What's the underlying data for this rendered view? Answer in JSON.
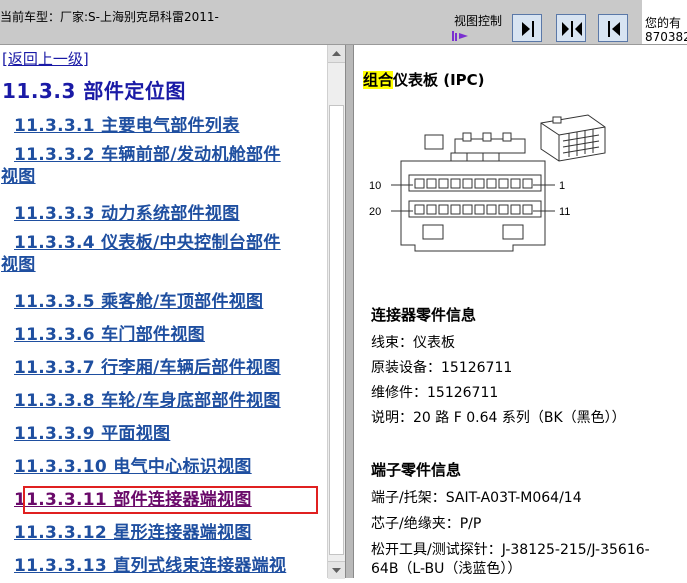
{
  "header": {
    "car_model": "当前车型：厂家:S-上海别克昂科雷2011-",
    "view_control_label": "视图控制",
    "user_line1": "您的有",
    "user_line2": "870382"
  },
  "toc": {
    "back_link": "[返回上一级]",
    "section_title": "11.3.3  部件定位图",
    "items": [
      {
        "label": "11.3.3.1  主要电气部件列表",
        "tail": ""
      },
      {
        "label": "11.3.3.2  车辆前部/发动机舱部件",
        "tail": "视图"
      },
      {
        "label": "11.3.3.3  动力系统部件视图",
        "tail": ""
      },
      {
        "label": "11.3.3.4  仪表板/中央控制台部件",
        "tail": "视图"
      },
      {
        "label": "11.3.3.5  乘客舱/车顶部件视图",
        "tail": ""
      },
      {
        "label": "11.3.3.6  车门部件视图",
        "tail": ""
      },
      {
        "label": "11.3.3.7  行李厢/车辆后部件视图",
        "tail": ""
      },
      {
        "label": "11.3.3.8  车轮/车身底部部件视图",
        "tail": ""
      },
      {
        "label": "11.3.3.9  平面视图",
        "tail": ""
      },
      {
        "label": "11.3.3.10  电气中心标识视图",
        "tail": ""
      },
      {
        "label": "11.3.3.11  部件连接器端视图",
        "tail": ""
      },
      {
        "label": "11.3.3.12  星形连接器端视图",
        "tail": ""
      },
      {
        "label": "11.3.3.13  直列式线束连接器端视",
        "tail": ""
      }
    ]
  },
  "component": {
    "title_highlight": "组合",
    "title_rest": "仪表板  (IPC)",
    "pin_labels": {
      "top_left": "10",
      "top_right": "1",
      "bottom_left": "20",
      "bottom_right": "11"
    }
  },
  "connector_info": {
    "heading": "连接器零件信息",
    "harness": "线束：仪表板",
    "oem": "原装设备：15126711",
    "service": "维修件：15126711",
    "desc": "说明：20 路  F 0.64 系列（BK（黑色））"
  },
  "terminal_info": {
    "heading": "端子零件信息",
    "terminal": "端子/托架：SAIT-A03T-M064/14",
    "core": "芯子/绝缘夹：P/P",
    "tool_line1": "松开工具/测试探针：J-38125-215/J-35616-",
    "tool_line2": "64B（L-BU（浅蓝色））"
  },
  "colors": {
    "link": "#1f4fa0",
    "visited": "#6a0a6a",
    "highlight_box": "#e02020",
    "title_highlight": "#ffff00"
  },
  "icons": {
    "next": "arrow-right-bar-icon",
    "split": "split-view-icon",
    "prev": "arrow-left-bar-icon"
  }
}
